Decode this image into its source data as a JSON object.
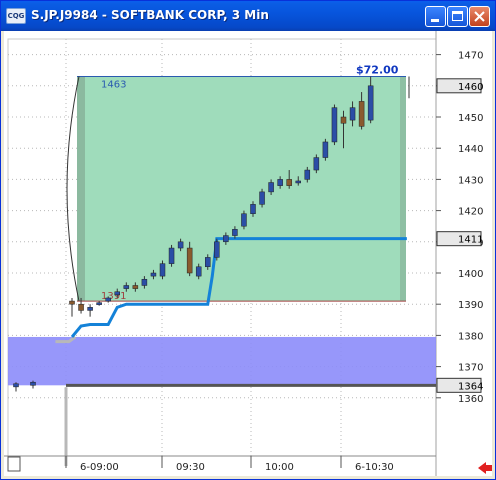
{
  "window": {
    "app_icon_label": "CQG",
    "title": "S.JP.J9984 - SOFTBANK CORP, 3 Min",
    "buttons": [
      "minimize",
      "maximize",
      "close"
    ]
  },
  "study": {
    "high_label": "1463",
    "low_label": "1391",
    "range_label": "$72.00"
  },
  "price_axis": {
    "ticks": [
      "1470",
      "1460",
      "1450",
      "1440",
      "1430",
      "1420",
      "1410",
      "1400",
      "1390",
      "1380",
      "1370",
      "1360"
    ],
    "last_price_marker": "1460",
    "blue_line_marker": "1411",
    "lower_marker": "1364"
  },
  "time_axis": {
    "ticks": [
      "6-09:00",
      "09:30",
      "10:00",
      "6-10:30"
    ]
  },
  "colors": {
    "title_bar": "#0a5fef",
    "range_fill": "#9fdcbb",
    "lower_band": "#8c8cfa",
    "up_candle": "#2b4ea6",
    "down_candle": "#8a5a2e",
    "blue_line": "#1482d8",
    "gray_line": "#b8b8b8",
    "nav_arrow": "#e02020"
  },
  "chart_data": {
    "type": "candlestick",
    "y_range": [
      1357,
      1475
    ],
    "y_axis": "right",
    "grid": true,
    "x": [
      "6-09:00",
      "09:30",
      "10:00",
      "6-10:30"
    ],
    "candles": [
      {
        "o": 1363.5,
        "h": 1365,
        "l": 1362,
        "c": 1364.5
      },
      {
        "o": 1364,
        "h": 1365.5,
        "l": 1363,
        "c": 1365
      },
      {
        "o": 1391,
        "h": 1392,
        "l": 1386,
        "c": 1390
      },
      {
        "o": 1390,
        "h": 1392,
        "l": 1387,
        "c": 1388
      },
      {
        "o": 1388,
        "h": 1390,
        "l": 1386,
        "c": 1389
      },
      {
        "o": 1390,
        "h": 1391,
        "l": 1389.5,
        "c": 1390.5
      },
      {
        "o": 1391,
        "h": 1392.5,
        "l": 1390.5,
        "c": 1392
      },
      {
        "o": 1393,
        "h": 1395,
        "l": 1392,
        "c": 1394
      },
      {
        "o": 1395,
        "h": 1397,
        "l": 1394,
        "c": 1396
      },
      {
        "o": 1396,
        "h": 1397,
        "l": 1394,
        "c": 1395
      },
      {
        "o": 1396,
        "h": 1399,
        "l": 1395,
        "c": 1398
      },
      {
        "o": 1399,
        "h": 1401,
        "l": 1398,
        "c": 1400
      },
      {
        "o": 1399,
        "h": 1404,
        "l": 1398,
        "c": 1403
      },
      {
        "o": 1403,
        "h": 1409,
        "l": 1402,
        "c": 1408
      },
      {
        "o": 1408,
        "h": 1411,
        "l": 1407,
        "c": 1410
      },
      {
        "o": 1408,
        "h": 1410,
        "l": 1399,
        "c": 1400
      },
      {
        "o": 1399,
        "h": 1403,
        "l": 1398,
        "c": 1402
      },
      {
        "o": 1402,
        "h": 1406,
        "l": 1401,
        "c": 1405
      },
      {
        "o": 1405,
        "h": 1411,
        "l": 1404,
        "c": 1410
      },
      {
        "o": 1410,
        "h": 1413,
        "l": 1409,
        "c": 1412
      },
      {
        "o": 1412,
        "h": 1415,
        "l": 1411,
        "c": 1414
      },
      {
        "o": 1415,
        "h": 1420,
        "l": 1414,
        "c": 1419
      },
      {
        "o": 1419,
        "h": 1423,
        "l": 1418,
        "c": 1422
      },
      {
        "o": 1422,
        "h": 1427,
        "l": 1421,
        "c": 1426
      },
      {
        "o": 1426,
        "h": 1430,
        "l": 1425,
        "c": 1429
      },
      {
        "o": 1428,
        "h": 1431,
        "l": 1427,
        "c": 1430
      },
      {
        "o": 1430,
        "h": 1433,
        "l": 1427,
        "c": 1428
      },
      {
        "o": 1429,
        "h": 1431,
        "l": 1428,
        "c": 1429.5
      },
      {
        "o": 1430,
        "h": 1434,
        "l": 1429,
        "c": 1433
      },
      {
        "o": 1433,
        "h": 1438,
        "l": 1432,
        "c": 1437
      },
      {
        "o": 1437,
        "h": 1443,
        "l": 1436,
        "c": 1442
      },
      {
        "o": 1442,
        "h": 1454,
        "l": 1441,
        "c": 1453
      },
      {
        "o": 1450,
        "h": 1452,
        "l": 1440,
        "c": 1448
      },
      {
        "o": 1449,
        "h": 1455,
        "l": 1447,
        "c": 1453
      },
      {
        "o": 1455,
        "h": 1458,
        "l": 1446,
        "c": 1447
      },
      {
        "o": 1449,
        "h": 1463,
        "l": 1448,
        "c": 1460
      }
    ],
    "blue_line": [
      [
        0,
        1379.5
      ],
      [
        1,
        1383
      ],
      [
        2,
        1383.5
      ],
      [
        3,
        1383.5
      ],
      [
        4,
        1383.5
      ],
      [
        5,
        1389
      ],
      [
        6,
        1390
      ],
      [
        14,
        1390
      ],
      [
        15,
        1390
      ],
      [
        15.5,
        1399
      ],
      [
        16,
        1411
      ],
      [
        20,
        1411
      ],
      [
        35,
        1411
      ],
      [
        37,
        1411
      ]
    ],
    "gray_line": [
      [
        -1.5,
        1378
      ],
      [
        0,
        1378
      ],
      [
        0.7,
        1379.5
      ]
    ],
    "range_box": {
      "high": 1463,
      "low": 1391
    },
    "lower_band": {
      "high": 1379.5,
      "low": 1364
    }
  }
}
